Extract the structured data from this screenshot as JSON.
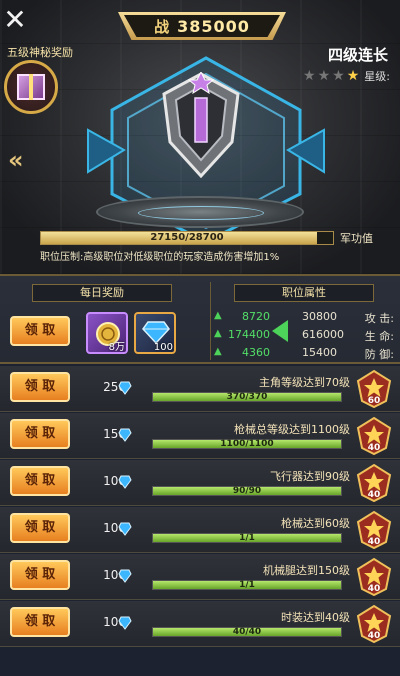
{
  "header": {
    "score": "385000",
    "rank_name": "四级连长",
    "star_label": "星级:",
    "stars_total": 4,
    "stars_filled": 1
  },
  "bonus": {
    "title": "五级神秘奖励"
  },
  "progress": {
    "label": "军功值",
    "text": "27150/28700",
    "current": 27150,
    "max": 28700,
    "notice": "职位压制:高级职位对低级职位的玩家造成伤害增加1%"
  },
  "attributes": {
    "title": "职位属性",
    "rows": [
      {
        "name": "攻",
        "sep": "击:",
        "base": "30800",
        "bonus": "8720"
      },
      {
        "name": "生",
        "sep": "命:",
        "base": "616000",
        "bonus": "174400"
      },
      {
        "name": "防",
        "sep": "御:",
        "base": "15400",
        "bonus": "4360"
      }
    ]
  },
  "daily": {
    "title": "每日奖励",
    "claim_label": "领 取",
    "items": [
      {
        "icon": "diamond-icon",
        "qty": "100",
        "color": "#3bb6ff"
      },
      {
        "icon": "gold-coin-icon",
        "qty": "8万",
        "color": "#e3b53c"
      }
    ]
  },
  "tasks": [
    {
      "title": "主角等级达到70级",
      "gems": "250",
      "progress_text": "370/370",
      "ratio": 1.0,
      "level": "60",
      "claim_label": "领 取"
    },
    {
      "title": "枪械总等级达到1100级",
      "gems": "150",
      "progress_text": "1100/1100",
      "ratio": 1.0,
      "level": "40",
      "claim_label": "领 取"
    },
    {
      "title": "飞行器达到90级",
      "gems": "100",
      "progress_text": "90/90",
      "ratio": 1.0,
      "level": "40",
      "claim_label": "领 取"
    },
    {
      "title": "枪械达到60级",
      "gems": "100",
      "progress_text": "1/1",
      "ratio": 1.0,
      "level": "40",
      "claim_label": "领 取"
    },
    {
      "title": "机械腿达到150级",
      "gems": "100",
      "progress_text": "1/1",
      "ratio": 1.0,
      "level": "40",
      "claim_label": "领 取"
    },
    {
      "title": "时装达到40级",
      "gems": "100",
      "progress_text": "40/40",
      "ratio": 1.0,
      "level": "40",
      "claim_label": "领 取"
    }
  ],
  "colors": {
    "gold": "#d7aa48",
    "progress_green": "#8fcf46",
    "claim_orange": "#f39a33",
    "hex_cyan": "#39b6e6"
  }
}
